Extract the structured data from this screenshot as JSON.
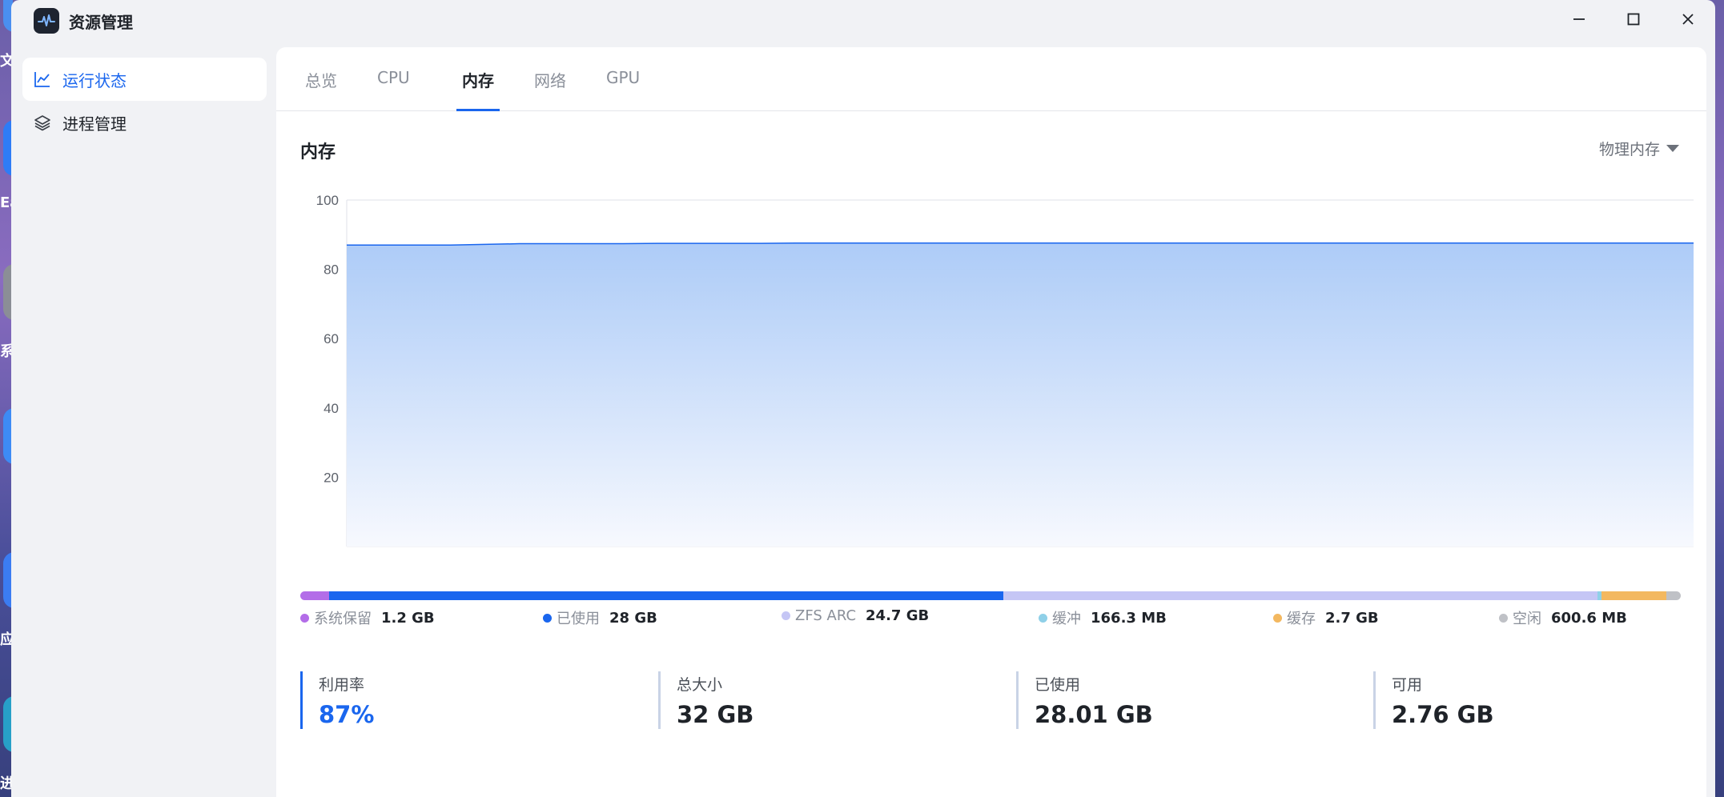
{
  "desktop": {
    "labels": [
      "文",
      "Ea",
      "系",
      "应",
      "进"
    ]
  },
  "window": {
    "title": "资源管理",
    "controls": {
      "minimize": "minimize",
      "maximize": "maximize",
      "close": "close"
    }
  },
  "sidebar": {
    "items": [
      {
        "label": "运行状态",
        "icon": "line-chart-icon",
        "active": true
      },
      {
        "label": "进程管理",
        "icon": "layers-icon",
        "active": false
      }
    ]
  },
  "tabs": [
    {
      "label": "总览",
      "active": false
    },
    {
      "label": "CPU",
      "active": false
    },
    {
      "label": "内存",
      "active": true
    },
    {
      "label": "网络",
      "active": false
    },
    {
      "label": "GPU",
      "active": false
    }
  ],
  "memory": {
    "title": "内存",
    "selector": "物理内存"
  },
  "chart_data": {
    "type": "area",
    "title": "",
    "xlabel": "",
    "ylabel": "",
    "ylim": [
      0,
      100
    ],
    "yticks": [
      20,
      40,
      60,
      80,
      100
    ],
    "grid": true,
    "series": [
      {
        "values": [
          87,
          87,
          87,
          87,
          87.2,
          87.4,
          87.4,
          87.4,
          87.4,
          87.5,
          87.5,
          87.5,
          87.5,
          87.6,
          87.6,
          87.6,
          87.6,
          87.6,
          87.6,
          87.6,
          87.6,
          87.6,
          87.6,
          87.6,
          87.6,
          87.6,
          87.6,
          87.6,
          87.6,
          87.6,
          87.6,
          87.6,
          87.6,
          87.6,
          87.6,
          87.6,
          87.6,
          87.6,
          87.6,
          87.6
        ]
      }
    ],
    "colors": {
      "line": "#1a66ee",
      "fill_top": "#a9c9f7",
      "fill_bottom": "#f7f9fe"
    }
  },
  "breakdown": {
    "items": [
      {
        "name": "系统保留",
        "value": "1.2 GB",
        "gb": 1.2,
        "color": "#b36de8"
      },
      {
        "name": "已使用",
        "value": "28 GB",
        "gb": 28,
        "color": "#1a66ee"
      },
      {
        "name": "ZFS ARC",
        "value": "24.7 GB",
        "gb": 24.7,
        "color": "#c5c6f5"
      },
      {
        "name": "缓冲",
        "value": "166.3 MB",
        "gb": 0.166,
        "color": "#8fd0e8"
      },
      {
        "name": "缓存",
        "value": "2.7 GB",
        "gb": 2.7,
        "color": "#f3b860"
      },
      {
        "name": "空闲",
        "value": "600.6 MB",
        "gb": 0.6,
        "color": "#bfc1c6"
      }
    ]
  },
  "stats": [
    {
      "label": "利用率",
      "value": "87%"
    },
    {
      "label": "总大小",
      "value": "32 GB"
    },
    {
      "label": "已使用",
      "value": "28.01 GB"
    },
    {
      "label": "可用",
      "value": "2.76 GB"
    }
  ]
}
